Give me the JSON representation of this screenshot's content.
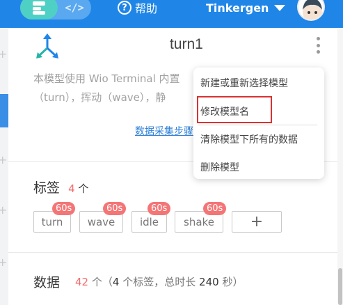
{
  "header": {
    "help_label": "帮助",
    "help_glyph": "?",
    "code_glyph": "</>",
    "username": "Tinkergen",
    "brand_color": "#1f86e8"
  },
  "model": {
    "name": "turn1",
    "description": "本模型使用 Wio Terminal 内置（turn），挥动（wave），静",
    "collect_link": "数据采集步骤"
  },
  "menu": {
    "items": [
      "新建或重新选择模型",
      "修改模型名",
      "清除模型下所有的数据",
      "删除模型"
    ]
  },
  "labels": {
    "title": "标签",
    "count": "4",
    "unit": "个",
    "tags": [
      {
        "name": "turn",
        "duration": "60s"
      },
      {
        "name": "wave",
        "duration": "60s"
      },
      {
        "name": "idle",
        "duration": "60s"
      },
      {
        "name": "shake",
        "duration": "60s"
      }
    ],
    "add_glyph": "+"
  },
  "data": {
    "title": "数据",
    "count": "42",
    "unit": "个",
    "open": "（",
    "label_count": "4",
    "label_text": "个标签，总时长",
    "duration": "240",
    "duration_unit": "秒",
    "close": "）"
  }
}
